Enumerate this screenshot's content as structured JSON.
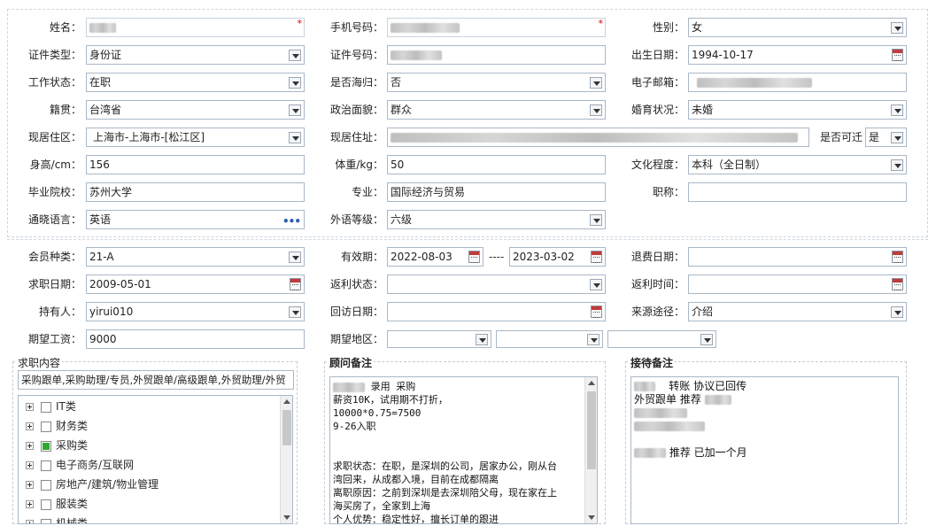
{
  "personal": {
    "name": {
      "label": "姓名：",
      "value": ""
    },
    "phone": {
      "label": "手机号码：",
      "value": ""
    },
    "gender": {
      "label": "性别：",
      "value": "女"
    },
    "id_type": {
      "label": "证件类型：",
      "value": "身份证"
    },
    "id_number": {
      "label": "证件号码：",
      "value": ""
    },
    "birth_date": {
      "label": "出生日期：",
      "value": "1994-10-17"
    },
    "work_status": {
      "label": "工作状态：",
      "value": "在职"
    },
    "returnee": {
      "label": "是否海归：",
      "value": "否"
    },
    "email": {
      "label": "电子邮箱：",
      "value": ""
    },
    "native_place": {
      "label": "籍贯：",
      "value": "台湾省"
    },
    "political": {
      "label": "政治面貌：",
      "value": "群众"
    },
    "marital": {
      "label": "婚育状况：",
      "value": "未婚"
    },
    "current_area": {
      "label": "现居住区：",
      "value": "上海市-上海市-[松江区]"
    },
    "current_address": {
      "label": "现居住址：",
      "value": ""
    },
    "can_contact": {
      "label": "是否可迁",
      "value": "是"
    },
    "height": {
      "label": "身高/cm：",
      "value": "156"
    },
    "weight": {
      "label": "体重/kg：",
      "value": "50"
    },
    "education": {
      "label": "文化程度：",
      "value": "本科（全日制）"
    },
    "school": {
      "label": "毕业院校：",
      "value": "苏州大学"
    },
    "major": {
      "label": "专业：",
      "value": "国际经济与贸易"
    },
    "job_title": {
      "label": "职称：",
      "value": ""
    },
    "language": {
      "label": "通晓语言：",
      "value": "英语"
    },
    "language_level": {
      "label": "外语等级：",
      "value": "六级"
    }
  },
  "membership": {
    "member_type": {
      "label": "会员种类：",
      "value": "21-A"
    },
    "valid_period": {
      "label": "有效期：",
      "from": "2022-08-03",
      "sep": "----",
      "to": "2023-03-02"
    },
    "refund_date": {
      "label": "退费日期：",
      "value": ""
    },
    "job_date": {
      "label": "求职日期：",
      "value": "2009-05-01"
    },
    "rebate_status": {
      "label": "返利状态：",
      "value": ""
    },
    "rebate_time": {
      "label": "返利时间：",
      "value": ""
    },
    "holder": {
      "label": "持有人：",
      "value": "yirui010"
    },
    "visit_date": {
      "label": "回访日期：",
      "value": ""
    },
    "source": {
      "label": "来源途径：",
      "value": "介绍"
    },
    "expected_salary": {
      "label": "期望工资：",
      "value": "9000"
    },
    "expected_area": {
      "label": "期望地区：",
      "values": [
        "",
        "",
        ""
      ]
    }
  },
  "job_content": {
    "title": "求职内容",
    "selected_text": "采购跟单,采购助理/专员,外贸跟单/高级跟单,外贸助理/外贸",
    "categories": [
      {
        "label": "IT类",
        "checked": false
      },
      {
        "label": "财务类",
        "checked": false
      },
      {
        "label": "采购类",
        "checked": true
      },
      {
        "label": "电子商务/互联网",
        "checked": false
      },
      {
        "label": "房地产/建筑/物业管理",
        "checked": false
      },
      {
        "label": "服装类",
        "checked": false
      },
      {
        "label": "机械类",
        "checked": false
      }
    ]
  },
  "advisor_notes": {
    "title": "顾问备注",
    "lines": [
      "录用 采购",
      "薪资10K，试用期不打折，",
      "10000*0.75=7500",
      "9-26入职",
      "",
      "",
      "求职状态：在职，是深圳的公司，居家办公，刚从台",
      "湾回来，从成都入境，目前在成都隔离",
      "离职原因：之前到深圳是去深圳陪父母，现在家在上",
      "海买房了，全家到上海",
      "个人优势：稳定性好，擅长订单的跟进"
    ]
  },
  "reception_notes": {
    "title": "接待备注",
    "lines": [
      "转账 协议已回传",
      "外贸跟单 推荐",
      "",
      "",
      "",
      "推荐 已加一个月"
    ]
  }
}
